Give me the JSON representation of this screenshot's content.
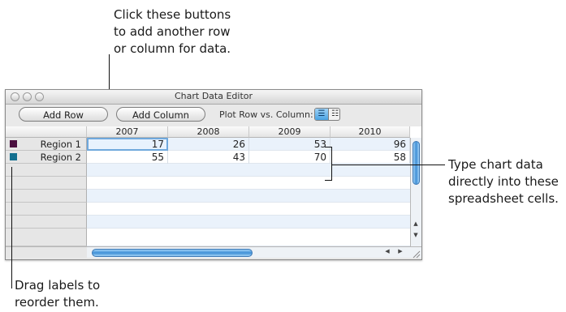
{
  "callouts": {
    "top": [
      "Click these buttons",
      "to add another row",
      "or column for data."
    ],
    "right": [
      "Type chart data",
      "directly into these",
      "spreadsheet cells."
    ],
    "bottom": [
      "Drag labels to",
      "reorder them."
    ]
  },
  "window": {
    "title": "Chart Data Editor",
    "toolbar": {
      "add_row": "Add Row",
      "add_column": "Add Column",
      "plot_label": "Plot Row vs. Column:"
    }
  },
  "table": {
    "columns": [
      "2007",
      "2008",
      "2009",
      "2010"
    ],
    "rows": [
      {
        "label": "Region 1",
        "color": "#4a0f3f",
        "values": [
          "17",
          "26",
          "53",
          "96"
        ]
      },
      {
        "label": "Region 2",
        "color": "#136f8f",
        "values": [
          "55",
          "43",
          "70",
          "58"
        ]
      }
    ],
    "empty_rows": 4
  },
  "icons": [
    "window-close-icon",
    "window-minimize-icon",
    "window-zoom-icon",
    "plot-rows-icon",
    "plot-columns-icon",
    "scroll-up-arrow-icon",
    "scroll-down-arrow-icon",
    "scroll-left-arrow-icon",
    "scroll-right-arrow-icon",
    "resize-grip-icon"
  ]
}
